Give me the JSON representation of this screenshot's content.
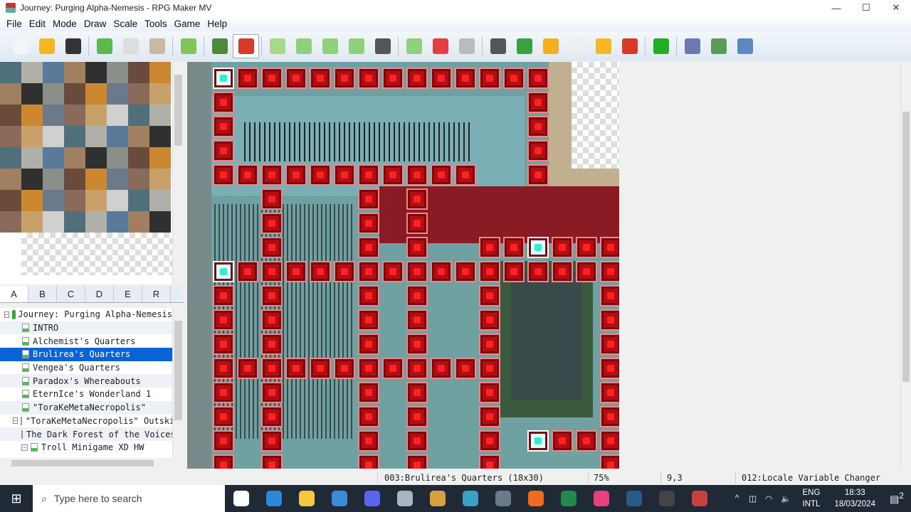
{
  "window": {
    "title": "Journey: Purging Alpha-Nemesis - RPG Maker MV",
    "controls": [
      "—",
      "☐",
      "✕"
    ]
  },
  "menu": [
    "File",
    "Edit",
    "Mode",
    "Draw",
    "Scale",
    "Tools",
    "Game",
    "Help"
  ],
  "toolbar": [
    {
      "icon": "new-project-icon",
      "color": "#f4f4f4"
    },
    {
      "icon": "open-project-icon",
      "color": "#f5b820"
    },
    {
      "icon": "save-project-icon",
      "color": "#333333"
    },
    "sep",
    {
      "icon": "cut-icon",
      "color": "#5bb84a"
    },
    {
      "icon": "copy-icon",
      "color": "#dddddd"
    },
    {
      "icon": "paste-icon",
      "color": "#c8b9a4"
    },
    "sep",
    {
      "icon": "undo-icon",
      "color": "#7fc55a"
    },
    "sep",
    {
      "icon": "map-mode-icon",
      "color": "#4a8a3a"
    },
    {
      "icon": "event-mode-icon",
      "color": "#d9392b",
      "active": true
    },
    "sep",
    {
      "icon": "pencil-icon",
      "color": "#a8d88a"
    },
    {
      "icon": "rectangle-icon",
      "color": "#8fd07a"
    },
    {
      "icon": "ellipse-icon",
      "color": "#8fd07a"
    },
    {
      "icon": "fill-icon",
      "color": "#8fd07a"
    },
    {
      "icon": "shadow-pen-icon",
      "color": "#555555"
    },
    "sep",
    {
      "icon": "zoom-in-icon",
      "color": "#8fd07a"
    },
    {
      "icon": "zoom-out-icon",
      "color": "#e04040"
    },
    {
      "icon": "actual-size-icon",
      "color": "#bbbbbb"
    },
    "sep",
    {
      "icon": "database-icon",
      "color": "#555555"
    },
    {
      "icon": "plugin-manager-icon",
      "color": "#3aa040"
    },
    {
      "icon": "sound-test-icon",
      "color": "#f2b020"
    },
    {
      "icon": "event-searcher-icon",
      "color": "#eeeeee"
    },
    {
      "icon": "resource-manager-icon",
      "color": "#f5b820"
    },
    {
      "icon": "character-generator-icon",
      "color": "#d9392b"
    },
    "sep",
    {
      "icon": "playtest-icon",
      "color": "#22b022"
    },
    "sep",
    {
      "icon": "deploy-icon",
      "color": "#6a7ab0"
    },
    {
      "icon": "steam-icon",
      "color": "#5a9a5a"
    },
    {
      "icon": "package-icon",
      "color": "#5a8ac0"
    }
  ],
  "tileset_tabs": [
    "A",
    "B",
    "C",
    "D",
    "E",
    "R"
  ],
  "selected_tab": "A",
  "map_tree": [
    {
      "label": "Journey: Purging Alpha-Nemesis",
      "level": 0,
      "type": "project",
      "expand": "⊟"
    },
    {
      "label": "INTRO",
      "level": 1
    },
    {
      "label": "Alchemist's Quarters",
      "level": 1
    },
    {
      "label": "Brulirea's Quarters",
      "level": 1,
      "selected": true
    },
    {
      "label": "Vengea's Quarters",
      "level": 1
    },
    {
      "label": "Paradox's Whereabouts",
      "level": 1
    },
    {
      "label": "EternIce's Wonderland 1",
      "level": 1
    },
    {
      "label": "\"ToraKeMetaNecropolis\"",
      "level": 1
    },
    {
      "label": "\"ToraKeMetaNecropolis\" Outskirts",
      "level": 1,
      "expand": "⊟"
    },
    {
      "label": "The Dark Forest of the Voices",
      "level": 2
    },
    {
      "label": "Troll Minigame XD HW",
      "level": 2,
      "expand": "⊟"
    }
  ],
  "status": {
    "map": "003:Brulirea's Quarters (18x30)",
    "zoom": "75%",
    "coords": "9,3",
    "event": "012:Locale Variable Changer"
  },
  "taskbar": {
    "search_placeholder": "Type here to search",
    "apps": [
      {
        "icon": "task-view-icon",
        "color": "#ffffff"
      },
      {
        "icon": "vscode-icon",
        "color": "#2a8ad8"
      },
      {
        "icon": "file-explorer-icon",
        "color": "#f5c842"
      },
      {
        "icon": "mail-icon",
        "color": "#3a8ad8"
      },
      {
        "icon": "discord-icon",
        "color": "#5865f2"
      },
      {
        "icon": "monitor-app-icon",
        "color": "#aab4c0"
      },
      {
        "icon": "paint-icon",
        "color": "#d8a040"
      },
      {
        "icon": "app-icon",
        "color": "#3aa0c8"
      },
      {
        "icon": "calculator-icon",
        "color": "#6a7a8a"
      },
      {
        "icon": "firefox-icon",
        "color": "#f06a20"
      },
      {
        "icon": "excel-icon",
        "color": "#1f8a4a"
      },
      {
        "icon": "app-pink-icon",
        "color": "#e8407a"
      },
      {
        "icon": "steam-icon",
        "color": "#2a5a8a"
      },
      {
        "icon": "obs-icon",
        "color": "#444444"
      },
      {
        "icon": "rpg-maker-icon",
        "color": "#c84040"
      }
    ],
    "lang": "ENG",
    "layout": "INTL",
    "time": "18:33",
    "date": "18/03/2024",
    "notifications": "2"
  }
}
